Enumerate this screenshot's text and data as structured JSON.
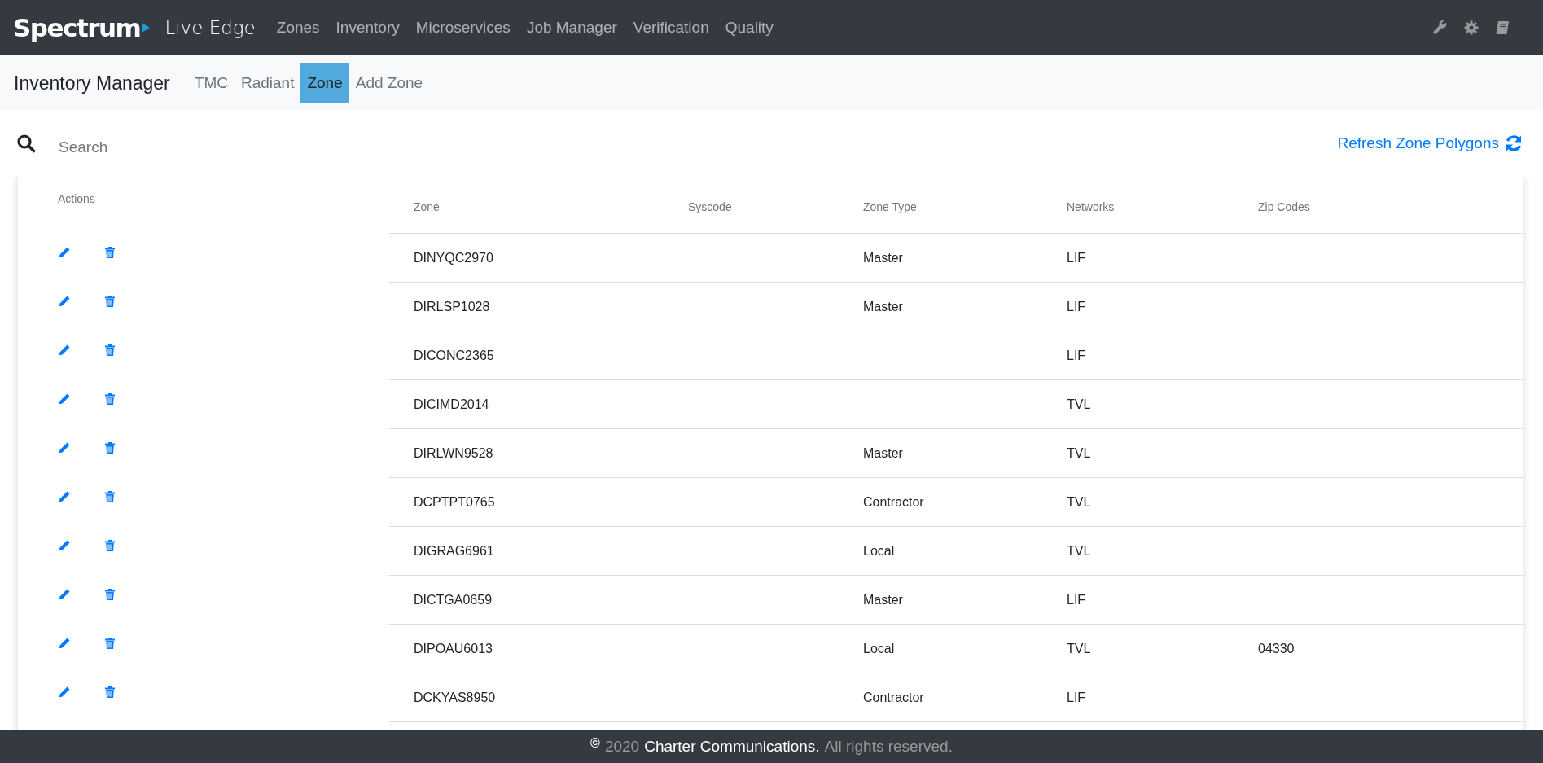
{
  "navbar": {
    "brand": "Spectrum",
    "app_name": "Live Edge",
    "menu": [
      {
        "label": "Zones"
      },
      {
        "label": "Inventory"
      },
      {
        "label": "Microservices"
      },
      {
        "label": "Job Manager"
      },
      {
        "label": "Verification"
      },
      {
        "label": "Quality"
      }
    ]
  },
  "subnav": {
    "title": "Inventory Manager",
    "tabs": [
      {
        "label": "TMC",
        "selected": false
      },
      {
        "label": "Radiant",
        "selected": false
      },
      {
        "label": "Zone",
        "selected": true
      },
      {
        "label": "Add Zone",
        "selected": false
      }
    ]
  },
  "search": {
    "placeholder": "Search"
  },
  "refresh_link": "Refresh Zone Polygons",
  "table": {
    "actions_header": "Actions",
    "columns": [
      "Zone",
      "Syscode",
      "Zone Type",
      "Networks",
      "Zip Codes"
    ],
    "rows": [
      {
        "zone": "DINYQC2970",
        "zone_type": "Master",
        "networks": "LIF"
      },
      {
        "zone": "DIRLSP1028",
        "zone_type": "Master",
        "networks": "LIF"
      },
      {
        "zone": "DICONC2365",
        "networks": "LIF"
      },
      {
        "zone": "DICIMD2014",
        "networks": "TVL"
      },
      {
        "zone": "DIRLWN9528",
        "zone_type": "Master",
        "networks": "TVL"
      },
      {
        "zone": "DCPTPT0765",
        "zone_type": "Contractor",
        "networks": "TVL"
      },
      {
        "zone": "DIGRAG6961",
        "zone_type": "Local",
        "networks": "TVL"
      },
      {
        "zone": "DICTGA0659",
        "zone_type": "Master",
        "networks": "LIF"
      },
      {
        "zone": "DIPOAU6013",
        "zone_type": "Local",
        "networks": "TVL",
        "zip_codes": "04330"
      },
      {
        "zone": "DCKYAS8950",
        "zone_type": "Contractor",
        "networks": "LIF"
      }
    ]
  },
  "footer": {
    "symbol": "©",
    "year": "2020",
    "company": "Charter Communications.",
    "rights": "All rights reserved."
  }
}
